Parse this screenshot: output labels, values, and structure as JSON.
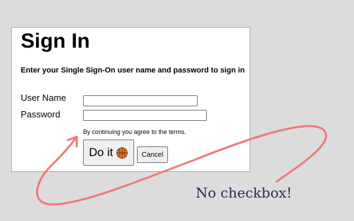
{
  "form": {
    "title": "Sign In",
    "subtitle": "Enter your Single Sign-On user name and password to sign in",
    "username_label": "User Name",
    "username_value": "",
    "password_label": "Password",
    "password_value": "",
    "terms_text": "By continuing you agree to the terms.",
    "submit_label": "Do it",
    "submit_icon": "basketball-icon",
    "cancel_label": "Cancel"
  },
  "annotation": {
    "text": "No checkbox!",
    "arrow_color": "#f07b79",
    "text_color": "#27285a"
  },
  "colors": {
    "background": "#dcdcdc",
    "panel": "#ffffff"
  }
}
